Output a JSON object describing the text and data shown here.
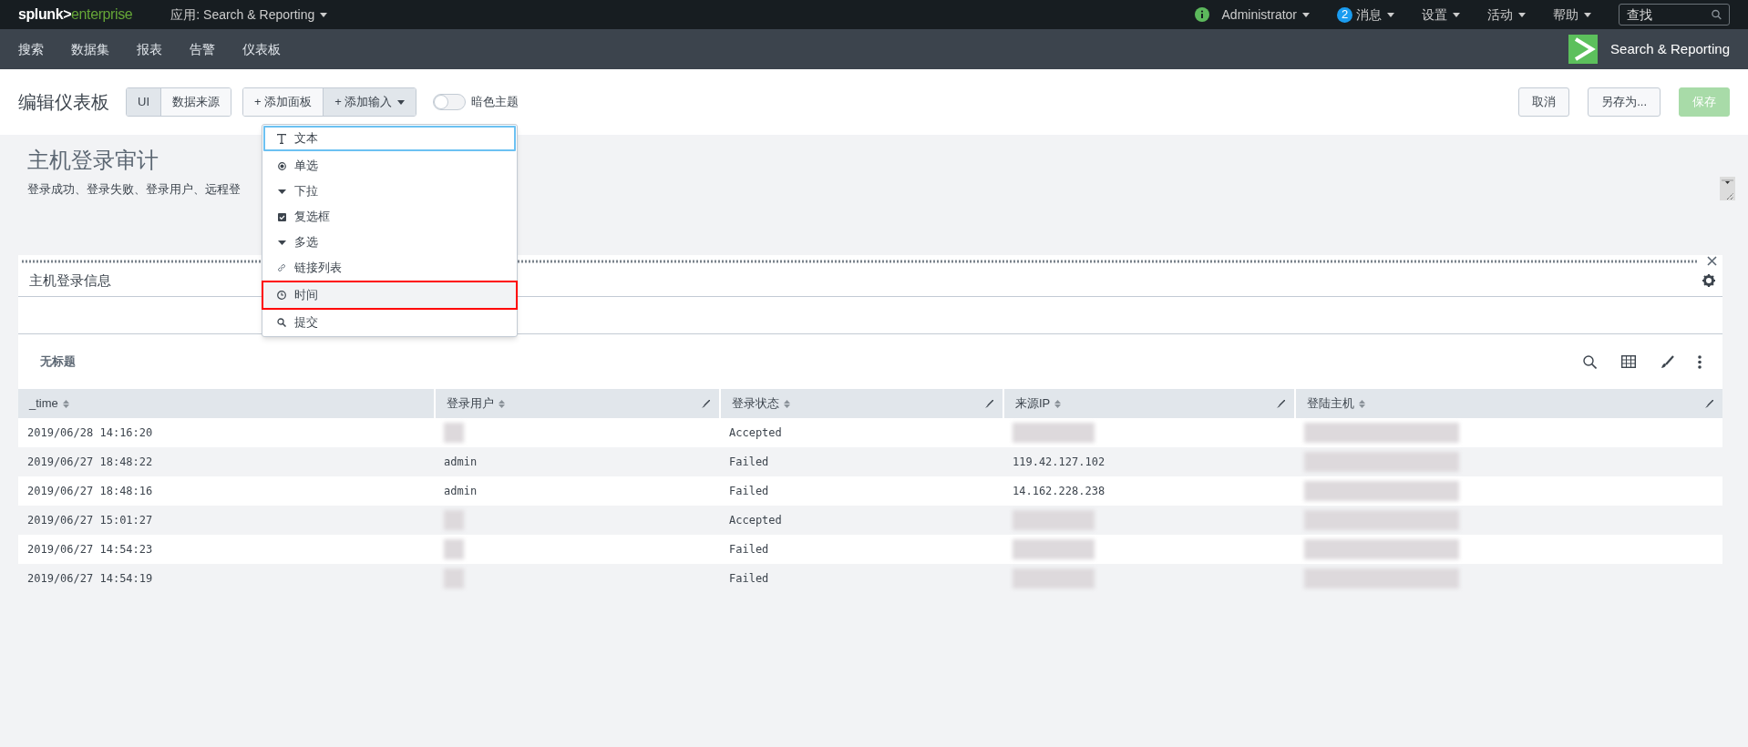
{
  "top_bar": {
    "logo": {
      "brand": "splunk>",
      "product": "enterprise"
    },
    "app_menu": "应用: Search & Reporting",
    "menus": [
      {
        "kind": "info",
        "label": "Administrator"
      },
      {
        "kind": "badge",
        "badge": "2",
        "label": "消息"
      },
      {
        "kind": "plain",
        "label": "设置"
      },
      {
        "kind": "plain",
        "label": "活动"
      },
      {
        "kind": "plain",
        "label": "帮助"
      }
    ],
    "search": {
      "placeholder": "查找"
    }
  },
  "nav": {
    "items": [
      "搜索",
      "数据集",
      "报表",
      "告警",
      "仪表板"
    ],
    "app_title": "Search & Reporting"
  },
  "edit_bar": {
    "title": "编辑仪表板",
    "mode_tabs": [
      {
        "label": "UI",
        "selected": true
      },
      {
        "label": "数据来源",
        "selected": false
      }
    ],
    "add_panel": "+ 添加面板",
    "add_input": "+ 添加输入",
    "dark_theme": {
      "label": "暗色主题",
      "on": false
    },
    "buttons": [
      {
        "kind": "secondary",
        "label": "取消"
      },
      {
        "kind": "secondary",
        "label": "另存为..."
      },
      {
        "kind": "primary",
        "label": "保存",
        "disabled": true
      }
    ]
  },
  "input_menu": {
    "items": [
      {
        "kind": "text",
        "label": "文本",
        "focused": true,
        "highlighted": false
      },
      {
        "kind": "radio",
        "label": "单选",
        "focused": false,
        "highlighted": false
      },
      {
        "kind": "dropdown",
        "label": "下拉",
        "focused": false,
        "highlighted": false
      },
      {
        "kind": "checkbox",
        "label": "复选框",
        "focused": false,
        "highlighted": false
      },
      {
        "kind": "dropdown",
        "label": "多选",
        "focused": false,
        "highlighted": false
      },
      {
        "kind": "link",
        "label": "链接列表",
        "focused": false,
        "highlighted": false
      },
      {
        "kind": "time",
        "label": "时间",
        "focused": false,
        "highlighted": true
      },
      {
        "kind": "submit",
        "label": "提交",
        "focused": false,
        "highlighted": false
      }
    ]
  },
  "dashboard": {
    "title": "主机登录审计",
    "description": "登录成功、登录失败、登录用户、远程登"
  },
  "panel": {
    "title": "主机登录信息",
    "subtitle": "无标题",
    "table": {
      "columns": [
        {
          "label": "_time",
          "editable": false
        },
        {
          "label": "登录用户",
          "editable": true
        },
        {
          "label": "登录状态",
          "editable": true
        },
        {
          "label": "来源IP",
          "editable": true
        },
        {
          "label": "登陆主机",
          "editable": true
        }
      ],
      "rows": [
        [
          {
            "text": "2019/06/28 14:16:20"
          },
          {
            "redacted": true
          },
          {
            "text": "Accepted"
          },
          {
            "redacted": true
          },
          {
            "redacted": true
          }
        ],
        [
          {
            "text": "2019/06/27 18:48:22"
          },
          {
            "text": "admin"
          },
          {
            "text": "Failed"
          },
          {
            "text": "119.42.127.102"
          },
          {
            "redacted": true
          }
        ],
        [
          {
            "text": "2019/06/27 18:48:16"
          },
          {
            "text": "admin"
          },
          {
            "text": "Failed"
          },
          {
            "text": "14.162.228.238"
          },
          {
            "redacted": true
          }
        ],
        [
          {
            "text": "2019/06/27 15:01:27"
          },
          {
            "redacted": true
          },
          {
            "text": "Accepted"
          },
          {
            "redacted": true
          },
          {
            "redacted": true
          }
        ],
        [
          {
            "text": "2019/06/27 14:54:23"
          },
          {
            "redacted": true
          },
          {
            "text": "Failed"
          },
          {
            "redacted": true
          },
          {
            "redacted": true
          }
        ],
        [
          {
            "text": "2019/06/27 14:54:19"
          },
          {
            "redacted": true
          },
          {
            "text": "Failed"
          },
          {
            "redacted": true
          },
          {
            "redacted": true
          }
        ]
      ]
    }
  }
}
